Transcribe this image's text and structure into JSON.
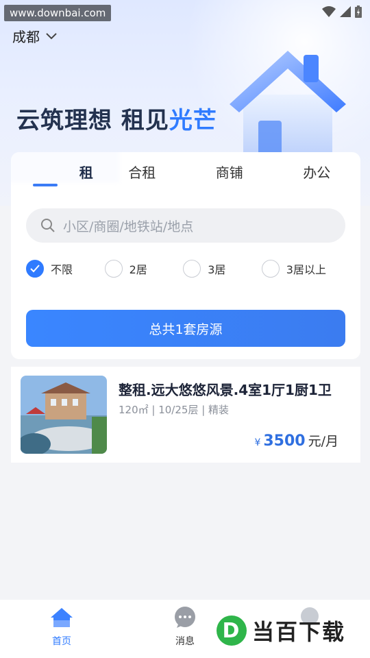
{
  "watermark": "www.downbai.com",
  "header": {
    "city": "成都"
  },
  "hero": {
    "slogan_a": "云筑理想 租见",
    "slogan_b": "光芒"
  },
  "tabs": [
    {
      "label": "租"
    },
    {
      "label": "合租"
    },
    {
      "label": "商铺"
    },
    {
      "label": "办公"
    }
  ],
  "search": {
    "placeholder": "小区/商圈/地铁站/地点"
  },
  "filters": [
    {
      "label": "不限",
      "checked": true
    },
    {
      "label": "2居",
      "checked": false
    },
    {
      "label": "3居",
      "checked": false
    },
    {
      "label": "3居以上",
      "checked": false
    }
  ],
  "cta": {
    "label": "总共1套房源"
  },
  "listings": [
    {
      "title": "整租.远大悠悠风景.4室1厅1厨1卫",
      "meta": "120㎡ | 10/25层 | 精装",
      "price_symbol": "¥",
      "price": "3500",
      "price_unit": "元/月"
    }
  ],
  "nav": {
    "home": "首页",
    "messages": "消息"
  },
  "brand": {
    "logo_letter": "D",
    "name": "当百下载"
  },
  "colors": {
    "accent": "#2f7bff",
    "title": "#23324f"
  }
}
